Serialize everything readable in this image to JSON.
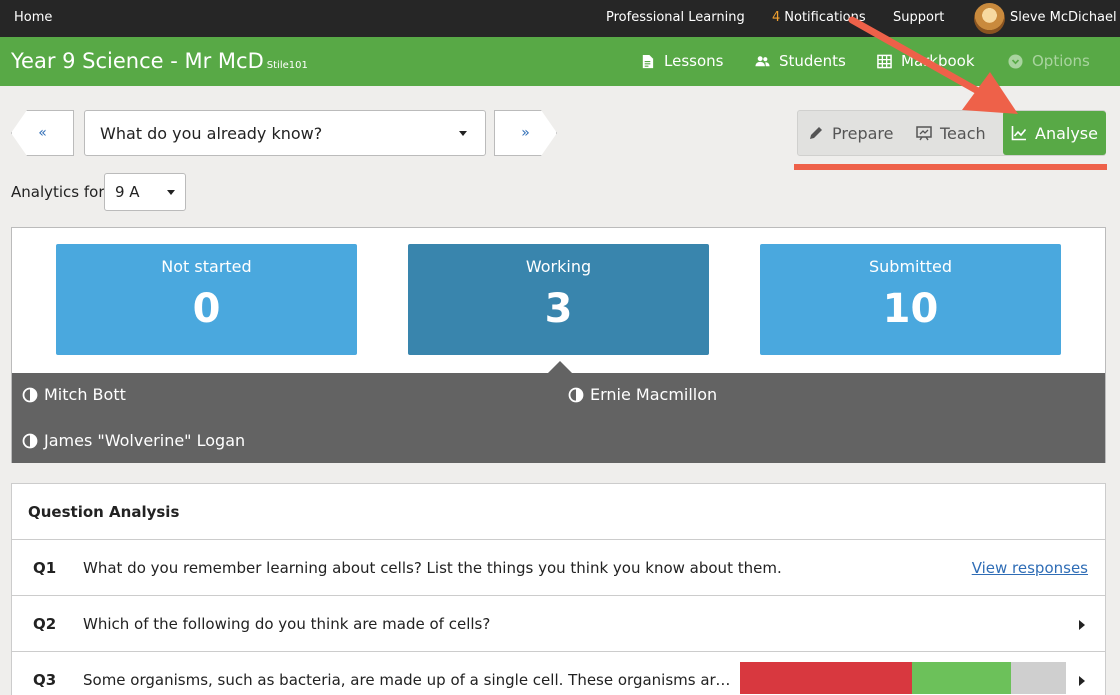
{
  "topbar": {
    "home": "Home",
    "professional_learning": "Professional Learning",
    "notification_count": "4",
    "notifications": "Notifications",
    "support": "Support",
    "user_name": "Sleve McDichael"
  },
  "header": {
    "title": "Year 9 Science - Mr McD",
    "class_code": "Stile101",
    "nav": {
      "lessons": "Lessons",
      "students": "Students",
      "markbook": "Markbook",
      "options": "Options"
    }
  },
  "lesson_nav": {
    "prev": "«",
    "next": "»",
    "selected_lesson": "What do you already know?"
  },
  "modes": {
    "prepare": "Prepare",
    "teach": "Teach",
    "analyse": "Analyse",
    "active": "analyse"
  },
  "analytics": {
    "label": "Analytics for",
    "class_value": "9 A"
  },
  "status": {
    "not_started": {
      "label": "Not started",
      "count": "0"
    },
    "working": {
      "label": "Working",
      "count": "3"
    },
    "submitted": {
      "label": "Submitted",
      "count": "10"
    },
    "working_students": [
      "Mitch Bott",
      "Ernie Macmillon",
      "James \"Wolverine\" Logan"
    ]
  },
  "question_analysis": {
    "title": "Question Analysis",
    "view_responses": "View responses",
    "questions": [
      {
        "number": "Q1",
        "text": "What do you remember learning about cells? List the things you think you know about them."
      },
      {
        "number": "Q2",
        "text": "Which of the following do you think are made of cells?"
      },
      {
        "number": "Q3",
        "text": "Some organisms, such as bacteria, are made up of a single cell. These organisms are described as unicellular.",
        "results": {
          "incorrect": 0.527,
          "correct": 0.303,
          "unanswered": 0.17
        }
      }
    ]
  },
  "colors": {
    "brand_green": "#58a946",
    "stat_blue": "#4aa8de",
    "stat_blue_active": "#3985ad",
    "annotation": "#ee6149",
    "incorrect": "#d8383f",
    "correct": "#6cc15a",
    "unanswered": "#cfcfcf"
  }
}
